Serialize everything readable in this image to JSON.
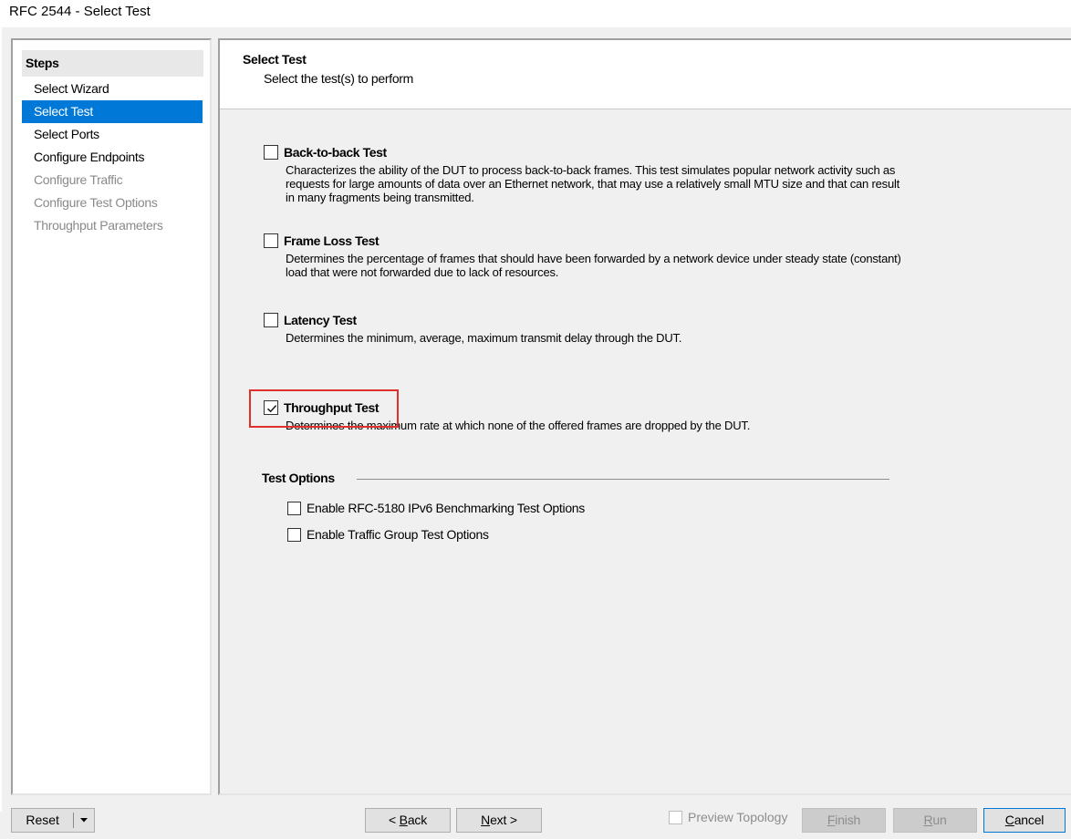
{
  "window": {
    "title": "RFC 2544 - Select Test"
  },
  "steps": {
    "header": "Steps",
    "items": [
      {
        "label": "Select Wizard",
        "state": "normal"
      },
      {
        "label": "Select Test",
        "state": "selected"
      },
      {
        "label": "Select Ports",
        "state": "normal"
      },
      {
        "label": "Configure Endpoints",
        "state": "normal"
      },
      {
        "label": "Configure Traffic",
        "state": "disabled"
      },
      {
        "label": "Configure Test Options",
        "state": "disabled"
      },
      {
        "label": "Throughput Parameters",
        "state": "disabled"
      }
    ]
  },
  "main": {
    "title": "Select Test",
    "subtitle": "Select the test(s) to perform",
    "tests": [
      {
        "label": "Back-to-back Test",
        "checked": false,
        "description": "Characterizes the ability of the DUT to process back-to-back frames. This test simulates popular network activity such as requests for large amounts of data over an Ethernet network, that may use a relatively small MTU size and that can result in many fragments being transmitted."
      },
      {
        "label": "Frame Loss Test",
        "checked": false,
        "description": "Determines the percentage of frames that should have been forwarded by a network device under steady state (constant) load that were not forwarded due to lack of resources."
      },
      {
        "label": "Latency Test",
        "checked": false,
        "description": "Determines the minimum, average, maximum transmit delay through the DUT."
      },
      {
        "label": "Throughput Test",
        "checked": true,
        "description": "Determines the maximum rate at which none of the offered frames are dropped by the DUT."
      }
    ],
    "options_title": "Test Options",
    "options": [
      {
        "label": "Enable RFC-5180 IPv6 Benchmarking Test Options",
        "checked": false
      },
      {
        "label": "Enable Traffic Group Test Options",
        "checked": false
      }
    ]
  },
  "footer": {
    "reset": "Reset",
    "back_prefix": "< ",
    "back_key": "B",
    "back_rest": "ack",
    "next_key": "N",
    "next_rest": "ext >",
    "preview_topology": "Preview Topology",
    "finish_key": "F",
    "finish_rest": "inish",
    "run_key": "R",
    "run_rest": "un",
    "cancel_key": "C",
    "cancel_rest": "ancel"
  },
  "colors": {
    "selection": "#0078d7",
    "highlight": "#e0302a"
  },
  "icons": {
    "checkmark": "check-icon",
    "dropdown": "chevron-down-icon"
  }
}
